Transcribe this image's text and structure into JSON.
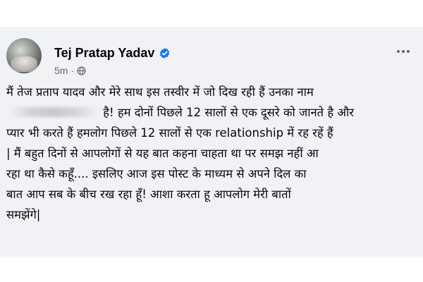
{
  "post": {
    "author": "Tej Pratap Yadav",
    "time": "5m",
    "separator": "·",
    "lines": [
      "मैं तेज प्रताप यादव और  मेरे साथ इस तस्वीर में जो दिख रही हैं उनका नाम",
      "है! हम दोनों पिछले 12 सालों से एक दूसरे को जानते है और",
      "प्यार भी करते हैं हमलोग पिछले 12 सालों से एक relationship में रह रहें हैं",
      "| मैं बहुत दिनों से आपलोगों से यह बात कहना चाहता था पर समझ नहीं आ",
      "रहा था कैसे कहूँ.... इसलिए आज इस पोस्ट के माध्यम से अपने दिल का",
      "बात आप सब के बीच रख रहा हूँ! आशा करता हू आपलोग मेरी बातों",
      "समझेंगे|"
    ]
  },
  "icons": {
    "verified": "verified-badge-icon",
    "audience": "globe-icon",
    "more": "more-options-icon"
  },
  "colors": {
    "background": "#f0f2f5",
    "text": "#050505",
    "meta": "#65676b",
    "verified": "#1877f2"
  }
}
